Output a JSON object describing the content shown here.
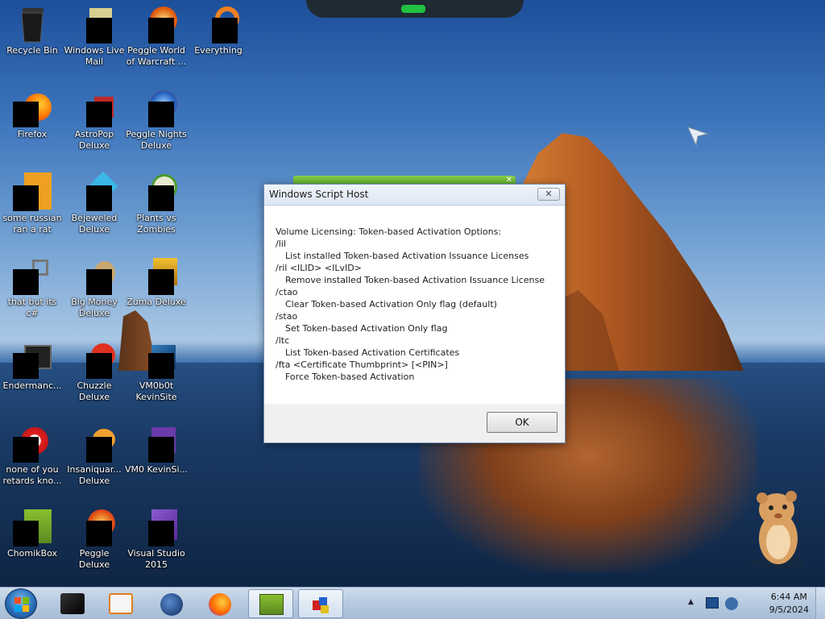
{
  "desktop": {
    "icons": [
      {
        "label": "Recycle Bin"
      },
      {
        "label": "Windows Live Mail"
      },
      {
        "label": "Peggle World of Warcraft ..."
      },
      {
        "label": "Everything"
      },
      {
        "label": "Firefox"
      },
      {
        "label": "AstroPop Deluxe"
      },
      {
        "label": "Peggle Nights Deluxe"
      },
      {
        "label": "some russian ran a rat"
      },
      {
        "label": "Bejeweled Deluxe"
      },
      {
        "label": "Plants vs Zombies"
      },
      {
        "label": "that but its c#"
      },
      {
        "label": "Big Money Deluxe"
      },
      {
        "label": "Zuma Deluxe"
      },
      {
        "label": "Endermanc..."
      },
      {
        "label": "Chuzzle Deluxe"
      },
      {
        "label": "VM0b0t KevinSite"
      },
      {
        "label": "none of you retards kno..."
      },
      {
        "label": "Insaniquar... Deluxe"
      },
      {
        "label": "VM0 KevinSi..."
      },
      {
        "label": "ChomikBox"
      },
      {
        "label": "Peggle Deluxe"
      },
      {
        "label": "Visual Studio 2015"
      }
    ]
  },
  "dialog": {
    "title": "Windows Script Host",
    "close_glyph": "✕",
    "lines": [
      {
        "text": "Volume Licensing: Token-based Activation Options:",
        "indent": false
      },
      {
        "text": "/lil",
        "indent": false
      },
      {
        "text": "List installed Token-based Activation Issuance Licenses",
        "indent": true
      },
      {
        "text": "/ril <ILID> <ILvID>",
        "indent": false
      },
      {
        "text": "Remove installed Token-based Activation Issuance License",
        "indent": true
      },
      {
        "text": "/ctao",
        "indent": false
      },
      {
        "text": "Clear Token-based Activation Only flag (default)",
        "indent": true
      },
      {
        "text": "/stao",
        "indent": false
      },
      {
        "text": "Set Token-based Activation Only flag",
        "indent": true
      },
      {
        "text": "/ltc",
        "indent": false
      },
      {
        "text": "List Token-based Activation Certificates",
        "indent": true
      },
      {
        "text": "/fta <Certificate Thumbprint> [<PIN>]",
        "indent": false
      },
      {
        "text": "Force Token-based Activation",
        "indent": true
      }
    ],
    "ok_label": "OK"
  },
  "taskbar": {
    "buttons": [
      {
        "icon": "black-box-icon"
      },
      {
        "icon": "media-player-icon"
      },
      {
        "icon": "globe-icon"
      },
      {
        "icon": "firefox-icon"
      },
      {
        "icon": "chomikbox-icon",
        "active": true
      },
      {
        "icon": "script-host-icon",
        "active": true
      }
    ],
    "clock": {
      "time": "6:44 AM",
      "date": "9/5/2024"
    }
  },
  "colors": {
    "dialog_border": "#6d8db8",
    "taskbar": "#b6c9df",
    "start_orb": "#2b6fb8"
  }
}
